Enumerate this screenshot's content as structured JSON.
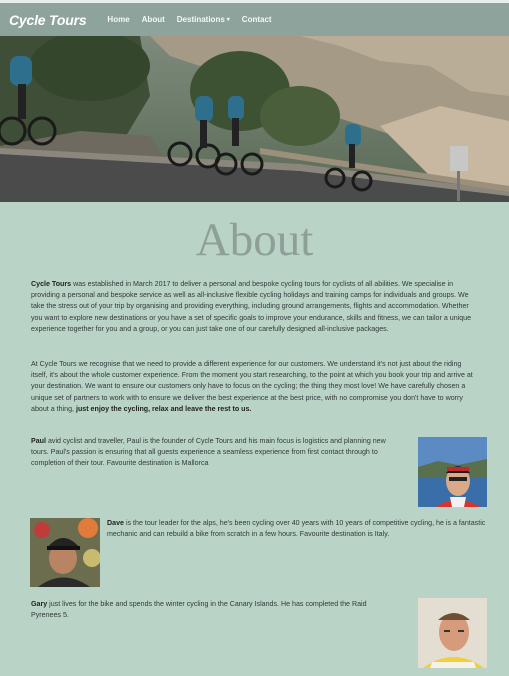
{
  "nav": {
    "brand": "Cycle Tours",
    "links": [
      "Home",
      "About",
      "Destinations",
      "Contact"
    ],
    "dropdown_caret": "▾"
  },
  "about": {
    "title": "About",
    "p1_lead": "Cycle Tours",
    "p1_rest": " was established in March 2017 to deliver a personal and bespoke cycling tours for cyclists of all abilities. We specialise in providing a personal and bespoke service as well as all-inclusive flexible cycling holidays and training camps for individuals and groups. We take the stress out of your trip by organising and providing everything, including ground arrangements, flights and accommodation. Whether you want to explore new destinations or you have a set of specific goals to improve your endurance, skills and fitness, we can tailor a unique experience together for you and a group, or you can just take one of our carefully designed all-inclusive packages.",
    "p2_rest": "At Cycle Tours we recognise that we need to provide a different experience for our customers. We understand it's not just about the riding itself, it's about the whole customer experience. From the moment you start researching, to the point at which you book your trip and arrive at your destination. We want to ensure our customers only have to focus on the cycling; the thing they most love! We have carefully chosen a unique set of partners to work with to ensure we deliver the best experience at the best price, with no compromise you don't have to worry about a thing,",
    "p2_bold": " just enjoy the cycling, relax and leave the rest to us."
  },
  "team": [
    {
      "name": "Paul",
      "bio": " avid cyclist and traveller, Paul is the founder of Cycle Tours and his main focus is logistics and planning new tours. Paul's passion is ensuring that all guests experience a seamless experience from first contact through to completion of their tour. Favourite destination is Mallorca"
    },
    {
      "name": "Dave",
      "bio": " is the tour leader for the alps, he's been cycling over 40 years with 10 years of competitive cycling, he is a fantastic mechanic and can rebuild a bike from scratch in a few hours. Favourite destination is Italy."
    },
    {
      "name": "Gary",
      "bio": " just lives for the bike and spends the winter cycling in the Canary Islands. He has completed the Raid Pyrenees 5."
    }
  ]
}
